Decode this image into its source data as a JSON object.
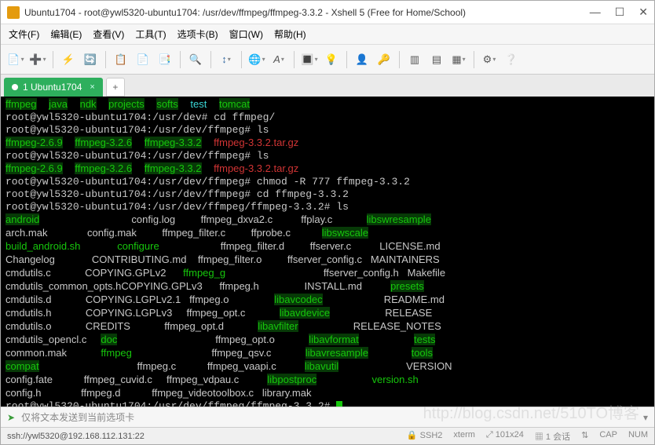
{
  "window": {
    "title": "Ubuntu1704 - root@ywl5320-ubuntu1704: /usr/dev/ffmpeg/ffmpeg-3.3.2 - Xshell 5 (Free for Home/School)"
  },
  "menu": {
    "file": "文件(F)",
    "edit": "编辑(E)",
    "view": "查看(V)",
    "tools": "工具(T)",
    "tabs": "选项卡(B)",
    "window": "窗口(W)",
    "help": "帮助(H)"
  },
  "tab": {
    "label": "1 Ubuntu1704"
  },
  "term": {
    "dirs_top": [
      "ffmpeg",
      "java",
      "ndk",
      "projects",
      "softs"
    ],
    "test": "test",
    "tomcat": "tomcat",
    "p1": "root@ywl5320-ubuntu1704:/usr/dev#",
    "cmd1": "cd ffmpeg/",
    "p2": "root@ywl5320-ubuntu1704:/usr/dev/ffmpeg#",
    "cmd2": "ls",
    "ffdirs": [
      "ffmpeg-2.6.9",
      "ffmpeg-3.2.6",
      "ffmpeg-3.3.2"
    ],
    "tar": "ffmpeg-3.3.2.tar.gz",
    "cmd3": "chmod -R 777 ffmpeg-3.3.2",
    "cmd4": "cd ffmpeg-3.3.2",
    "p3": "root@ywl5320-ubuntu1704:/usr/dev/ffmpeg/ffmpeg-3.3.2#",
    "cmd5": "ls",
    "cols": [
      [
        {
          "t": "android",
          "c": "g"
        },
        {
          "t": "arch.mak",
          "c": "w"
        },
        {
          "t": "build_android.sh",
          "c": "lg"
        },
        {
          "t": "Changelog",
          "c": "w"
        },
        {
          "t": "cmdutils.c",
          "c": "w"
        },
        {
          "t": "cmdutils_common_opts.h",
          "c": "w"
        },
        {
          "t": "cmdutils.d",
          "c": "w"
        },
        {
          "t": "cmdutils.h",
          "c": "w"
        },
        {
          "t": "cmdutils.o",
          "c": "w"
        },
        {
          "t": "cmdutils_opencl.c",
          "c": "w"
        },
        {
          "t": "common.mak",
          "c": "w"
        },
        {
          "t": "compat",
          "c": "g"
        },
        {
          "t": "config.fate",
          "c": "w"
        },
        {
          "t": "config.h",
          "c": "w"
        }
      ],
      [
        {
          "t": "config.log",
          "c": "w"
        },
        {
          "t": "config.mak",
          "c": "w"
        },
        {
          "t": "configure",
          "c": "lg"
        },
        {
          "t": "CONTRIBUTING.md",
          "c": "w"
        },
        {
          "t": "COPYING.GPLv2",
          "c": "w"
        },
        {
          "t": "COPYING.GPLv3",
          "c": "w"
        },
        {
          "t": "COPYING.LGPLv2.1",
          "c": "w"
        },
        {
          "t": "COPYING.LGPLv3",
          "c": "w"
        },
        {
          "t": "CREDITS",
          "c": "w"
        },
        {
          "t": "doc",
          "c": "g"
        },
        {
          "t": "ffmpeg",
          "c": "lg"
        },
        {
          "t": "ffmpeg.c",
          "c": "w"
        },
        {
          "t": "ffmpeg_cuvid.c",
          "c": "w"
        },
        {
          "t": "ffmpeg.d",
          "c": "w"
        }
      ],
      [
        {
          "t": "ffmpeg_dxva2.c",
          "c": "w"
        },
        {
          "t": "ffmpeg_filter.c",
          "c": "w"
        },
        {
          "t": "ffmpeg_filter.d",
          "c": "w"
        },
        {
          "t": "ffmpeg_filter.o",
          "c": "w"
        },
        {
          "t": "ffmpeg_g",
          "c": "lg"
        },
        {
          "t": "ffmpeg.h",
          "c": "w"
        },
        {
          "t": "ffmpeg.o",
          "c": "w"
        },
        {
          "t": "ffmpeg_opt.c",
          "c": "w"
        },
        {
          "t": "ffmpeg_opt.d",
          "c": "w"
        },
        {
          "t": "ffmpeg_opt.o",
          "c": "w"
        },
        {
          "t": "ffmpeg_qsv.c",
          "c": "w"
        },
        {
          "t": "ffmpeg_vaapi.c",
          "c": "w"
        },
        {
          "t": "ffmpeg_vdpau.c",
          "c": "w"
        },
        {
          "t": "ffmpeg_videotoolbox.c",
          "c": "w"
        }
      ],
      [
        {
          "t": "ffplay.c",
          "c": "w"
        },
        {
          "t": "ffprobe.c",
          "c": "w"
        },
        {
          "t": "ffserver.c",
          "c": "w"
        },
        {
          "t": "ffserver_config.c",
          "c": "w"
        },
        {
          "t": "ffserver_config.h",
          "c": "w"
        },
        {
          "t": "INSTALL.md",
          "c": "w"
        },
        {
          "t": "libavcodec",
          "c": "g"
        },
        {
          "t": "libavdevice",
          "c": "g"
        },
        {
          "t": "libavfilter",
          "c": "g"
        },
        {
          "t": "libavformat",
          "c": "g"
        },
        {
          "t": "libavresample",
          "c": "g"
        },
        {
          "t": "libavutil",
          "c": "g"
        },
        {
          "t": "libpostproc",
          "c": "g"
        },
        {
          "t": "library.mak",
          "c": "w"
        }
      ],
      [
        {
          "t": "libswresample",
          "c": "g"
        },
        {
          "t": "libswscale",
          "c": "g"
        },
        {
          "t": "LICENSE.md",
          "c": "w"
        },
        {
          "t": "MAINTAINERS",
          "c": "w"
        },
        {
          "t": "Makefile",
          "c": "w"
        },
        {
          "t": "presets",
          "c": "g"
        },
        {
          "t": "README.md",
          "c": "w"
        },
        {
          "t": "RELEASE",
          "c": "w"
        },
        {
          "t": "RELEASE_NOTES",
          "c": "w"
        },
        {
          "t": "tests",
          "c": "g"
        },
        {
          "t": "tools",
          "c": "g"
        },
        {
          "t": "VERSION",
          "c": "w"
        },
        {
          "t": "version.sh",
          "c": "lg"
        },
        {
          "t": "",
          "c": "w"
        }
      ]
    ]
  },
  "sendbar": {
    "text": "仅将文本发送到当前选项卡"
  },
  "status": {
    "conn": "ssh://ywl5320@192.168.112.131:22",
    "ssh": "SSH2",
    "type": "xterm",
    "size": "101x24",
    "sess": "1 会话",
    "cap": "CAP",
    "num": "NUM"
  },
  "watermark": "http://blog.csdn.net/510TO博客"
}
